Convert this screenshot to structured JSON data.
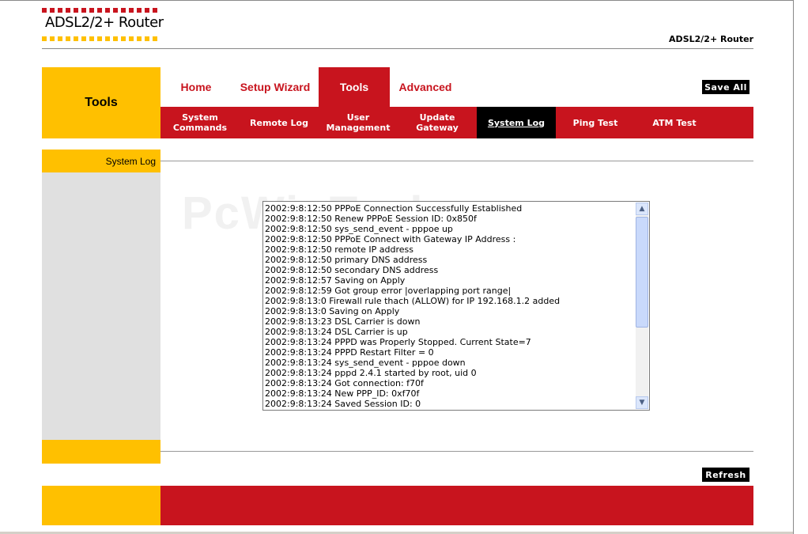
{
  "header": {
    "logo_text": "ADSL2/2+ Router",
    "title": "ADSL2/2+ Router"
  },
  "section": {
    "title": "Tools"
  },
  "tabs": [
    {
      "label": "Home",
      "active": false
    },
    {
      "label": "Setup Wizard",
      "active": false
    },
    {
      "label": "Tools",
      "active": true
    },
    {
      "label": "Advanced",
      "active": false
    }
  ],
  "subtabs": [
    {
      "label": "System\nCommands",
      "active": false
    },
    {
      "label": "Remote Log",
      "active": false
    },
    {
      "label": "User\nManagement",
      "active": false
    },
    {
      "label": "Update\nGateway",
      "active": false
    },
    {
      "label": "System Log",
      "active": true
    },
    {
      "label": "Ping Test",
      "active": false
    },
    {
      "label": "ATM Test",
      "active": false
    }
  ],
  "buttons": {
    "save_all": "Save All",
    "refresh": "Refresh"
  },
  "sidebar": {
    "heading": "System Log"
  },
  "watermark": "PcWinTech.com",
  "log": {
    "lines": [
      "2002:9:8:12:50 PPPoE Connection Successfully Established",
      "2002:9:8:12:50 Renew PPPoE Session ID: 0x850f",
      "2002:9:8:12:50 sys_send_event - pppoe up",
      "2002:9:8:12:50 PPPoE Connect with Gateway IP Address :",
      "2002:9:8:12:50 remote IP address",
      "2002:9:8:12:50 primary   DNS address",
      "2002:9:8:12:50 secondary DNS address",
      "2002:9:8:12:57 Saving on Apply",
      "2002:9:8:12:59 Got group error |overlapping port range|",
      "2002:9:8:13:0 Firewall rule thach (ALLOW) for IP 192.168.1.2 added",
      "2002:9:8:13:0 Saving on Apply",
      "2002:9:8:13:23 DSL Carrier is down",
      "2002:9:8:13:24 DSL Carrier is up",
      "2002:9:8:13:24 PPPD was Properly Stopped. Current State=7",
      "2002:9:8:13:24 PPPD Restart Filter = 0",
      "2002:9:8:13:24 sys_send_event - pppoe down",
      "2002:9:8:13:24 pppd 2.4.1 started by root, uid 0",
      "2002:9:8:13:24 Got connection: f70f",
      "2002:9:8:13:24 New PPP_ID: 0xf70f",
      "2002:9:8:13:24 Saved Session ID: 0"
    ]
  },
  "colors": {
    "brand_red": "#c8141e",
    "brand_yellow": "#ffc000",
    "sidebar_gray": "#e0e0e0"
  }
}
